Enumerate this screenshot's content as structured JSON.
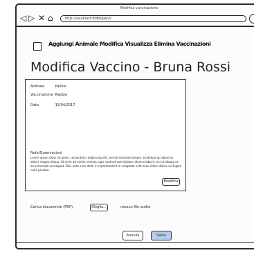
{
  "window": {
    "title": "Modifica vaccinazione",
    "url": "http://localhost:8080/pet/V"
  },
  "header": {
    "nav_text": "Aggiungi Animale Modifica Visualizza Elimina Vaccinazioni"
  },
  "page": {
    "title": "Modifica Vaccino - Bruna Rossi"
  },
  "details": {
    "fields": [
      {
        "label": "Animale",
        "value": "Pallino"
      },
      {
        "label": "Vaccinazione",
        "value": "Rabbia"
      },
      {
        "label": "Data",
        "value": "15/04/2017"
      }
    ],
    "notes_label": "Note/Osservazioni",
    "notes": "Lorem ipsum dolor sit amet, consectetur adipiscing elit, sed do eiusmod tempor incididunt ut labore et dolore magna aliqua. Ut enim ad minim veniam, quis nostrud exercitation ullamco laboris nisi ut aliquip ex ea commodo consequat. Duis aute irure dolor in reprehenderit in voluptate velit esse cillum dolore eu fugiat nulla pariatur.",
    "edit_button": "Modifica"
  },
  "attachment": {
    "label": "Carica documento (PDF):",
    "browse_button": "Sfoglia...",
    "status": "nessun file scelto"
  },
  "actions": {
    "cancel": "Annulla",
    "save": "Salva"
  }
}
